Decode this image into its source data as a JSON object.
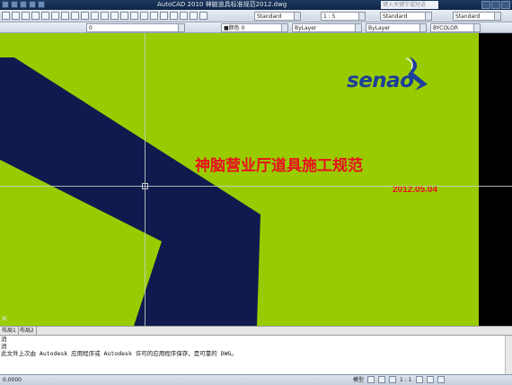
{
  "titlebar": {
    "title": "AutoCAD 2010    神脑道具标准规范2012.dwg",
    "help_placeholder": "键入关键字或短语"
  },
  "toolbar1": {
    "text_style": "Standard",
    "scale": "1 : 5",
    "dim_style": "Standard",
    "table_style": "Standard"
  },
  "toolbar2": {
    "layer": "0",
    "color": "■颜色 0",
    "linetype": "ByLayer",
    "lineweight": "ByLayer",
    "plotstyle": "BYCOLOR"
  },
  "drawing": {
    "logo_text": "senao",
    "title": "神脑营业厅道具施工规范",
    "date": "2012.05.04",
    "colors": {
      "background": "#99cc00",
      "chevron": "#0f1a4f",
      "title": "#e8101e",
      "logo": "#1d3e9a"
    }
  },
  "layout_tabs": [
    "布局1",
    "布局2"
  ],
  "command_lines": [
    "消",
    "消",
    "此文件上次由 Autodesk 应用程序或 Autodesk 许可的应用程序保存，是可靠的 DWG。"
  ],
  "status": {
    "coords": "0.0000",
    "model_label": "模型",
    "scale": "1 : 1"
  }
}
